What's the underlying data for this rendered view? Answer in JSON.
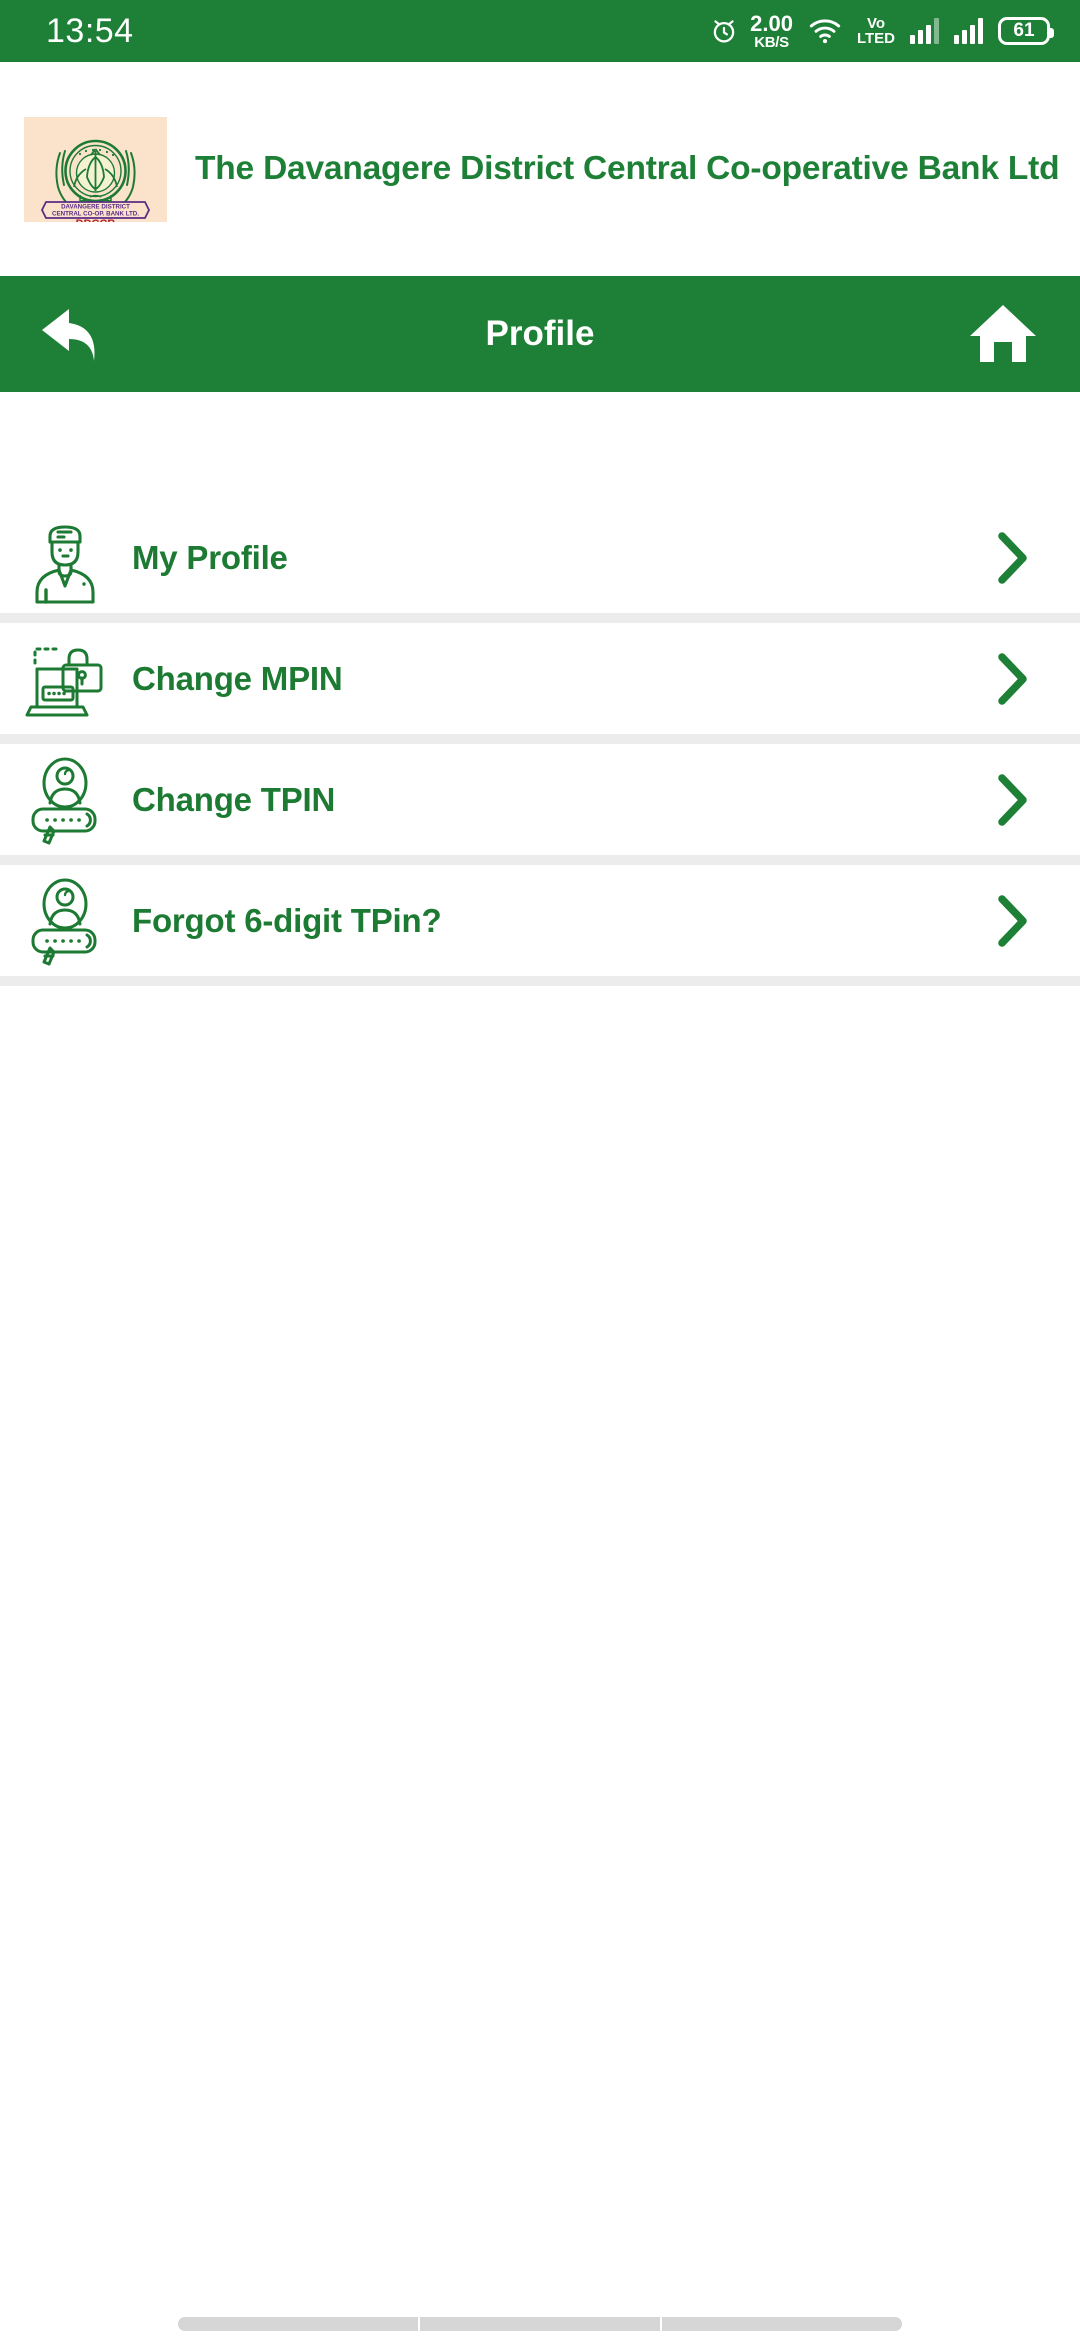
{
  "status_bar": {
    "time": "13:54",
    "net_speed_value": "2.00",
    "net_speed_unit": "KB/S",
    "volte_top": "Vo",
    "volte_bottom": "LTED",
    "battery_percent": "61",
    "icons": [
      "alarm-icon",
      "wifi-icon",
      "volte-icon",
      "signal-icon-sim1",
      "signal-icon-sim2",
      "battery-icon"
    ]
  },
  "brand": {
    "bank_name": "The Davanagere District Central Co-operative Bank Ltd",
    "logo_alt": "bank-logo",
    "logo_banner_text": "DAVANGERE DISTRICT CENTRAL CO-OP. BANK LTD.",
    "logo_abbreviation": "DDCCB",
    "logo_bg_color": "#fbe3cb",
    "brand_color": "#1d8036"
  },
  "app_bar": {
    "title": "Profile",
    "back_icon": "back-arrow-icon",
    "home_icon": "home-icon",
    "bg_color": "#1d8036",
    "text_color": "#ffffff"
  },
  "menu": {
    "items": [
      {
        "label": "My Profile",
        "icon": "user-profile-icon",
        "chevron": "chevron-right-icon"
      },
      {
        "label": "Change MPIN",
        "icon": "device-lock-icon",
        "chevron": "chevron-right-icon"
      },
      {
        "label": "Change TPIN",
        "icon": "avatar-pin-icon",
        "chevron": "chevron-right-icon"
      },
      {
        "label": "Forgot 6-digit TPin?",
        "icon": "avatar-pin-icon",
        "chevron": "chevron-right-icon"
      }
    ],
    "item_color": "#1d7a33",
    "separator_color": "#ececec"
  },
  "nav_bar": {
    "segments": [
      "recents-pill",
      "home-pill",
      "back-pill"
    ],
    "color": "#d6d6d6"
  }
}
